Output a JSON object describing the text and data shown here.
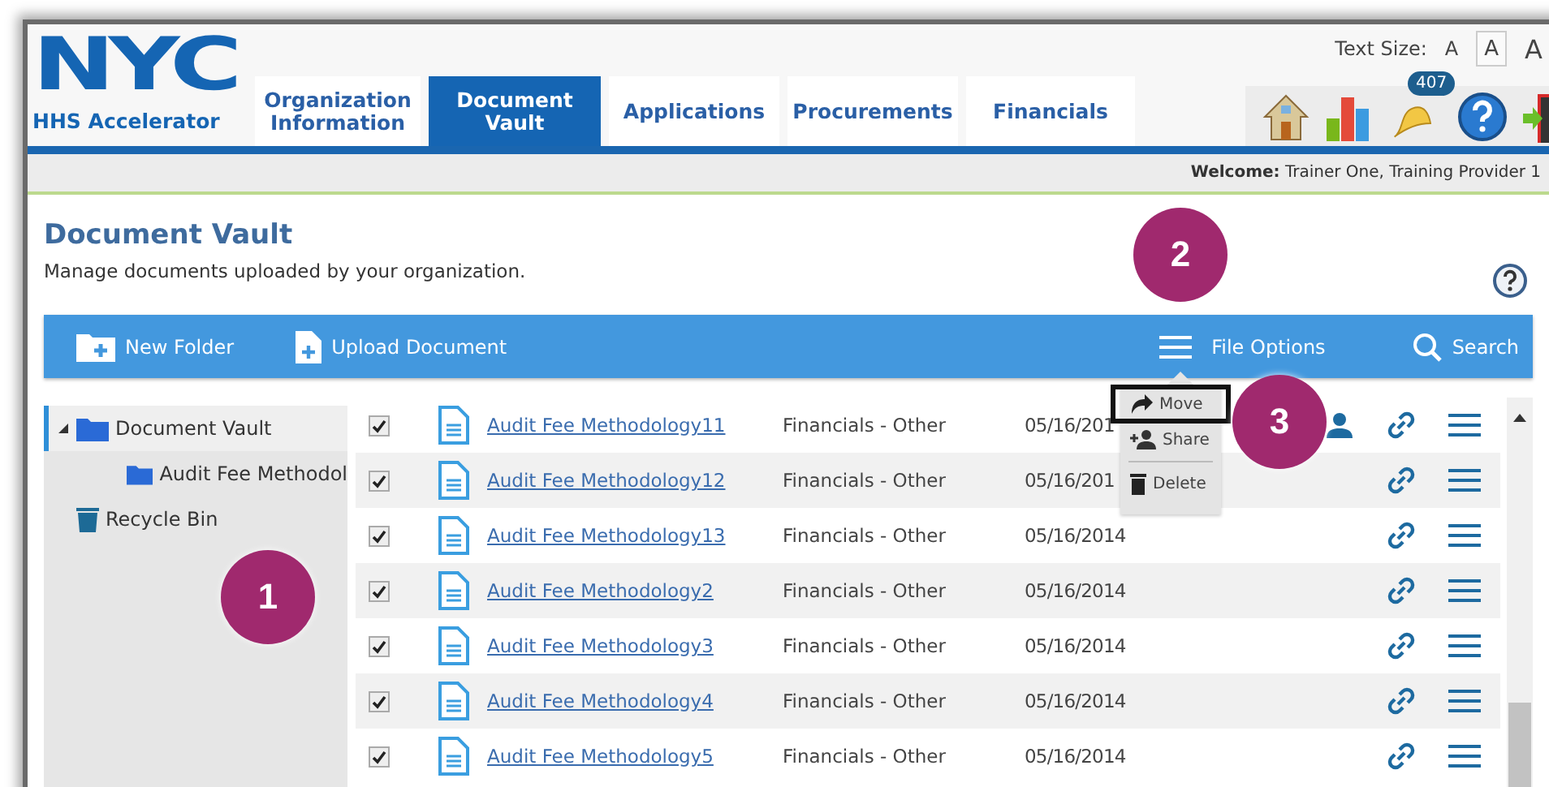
{
  "logo": {
    "mark": "NYC",
    "subtitle": "HHS Accelerator"
  },
  "text_size": {
    "label": "Text Size:",
    "options": [
      {
        "label": "A",
        "selected": false
      },
      {
        "label": "A",
        "selected": true
      },
      {
        "label": "A",
        "selected": false
      }
    ]
  },
  "tabs": [
    {
      "label": "Organization Information",
      "selected": false
    },
    {
      "label": "Document Vault",
      "selected": true
    },
    {
      "label": "Applications",
      "selected": false
    },
    {
      "label": "Procurements",
      "selected": false
    },
    {
      "label": "Financials",
      "selected": false
    }
  ],
  "notifications": {
    "badge": "407"
  },
  "welcome": "**Welcome:** Trainer One, Training Provider 1",
  "page": {
    "title": "Document Vault",
    "subtitle": "Manage documents uploaded by your organization."
  },
  "toolbar": {
    "new_folder": "New Folder",
    "upload": "Upload Document",
    "file_options": "File Options",
    "search": "Search"
  },
  "tree": [
    {
      "label": "Document Vault",
      "kind": "folder",
      "expanded": true,
      "selected": true,
      "children": [
        {
          "label": "Audit Fee Methodol",
          "kind": "folder",
          "selected": false
        }
      ]
    },
    {
      "label": "Recycle Bin",
      "kind": "bin",
      "selected": false
    }
  ],
  "rows": [
    {
      "checked": true,
      "name": "Audit Fee Methodology11",
      "type": "Financials - Other",
      "date": "05/16/201",
      "shared": true
    },
    {
      "checked": true,
      "name": "Audit Fee Methodology12",
      "type": "Financials - Other",
      "date": "05/16/201",
      "shared": false
    },
    {
      "checked": true,
      "name": "Audit Fee Methodology13",
      "type": "Financials - Other",
      "date": "05/16/2014",
      "shared": false
    },
    {
      "checked": true,
      "name": "Audit Fee Methodology2",
      "type": "Financials - Other",
      "date": "05/16/2014",
      "shared": false
    },
    {
      "checked": true,
      "name": "Audit Fee Methodology3",
      "type": "Financials - Other",
      "date": "05/16/2014",
      "shared": false
    },
    {
      "checked": true,
      "name": "Audit Fee Methodology4",
      "type": "Financials - Other",
      "date": "05/16/2014",
      "shared": false
    },
    {
      "checked": true,
      "name": "Audit Fee Methodology5",
      "type": "Financials - Other",
      "date": "05/16/2014",
      "shared": false
    }
  ],
  "file_menu": [
    {
      "kind": "move",
      "label": "Move",
      "highlighted": true
    },
    {
      "kind": "share",
      "label": "Share",
      "highlighted": false
    },
    {
      "kind": "delete",
      "label": "Delete",
      "highlighted": false
    }
  ],
  "callouts": [
    {
      "label": "1"
    },
    {
      "label": "2"
    },
    {
      "label": "3"
    }
  ]
}
